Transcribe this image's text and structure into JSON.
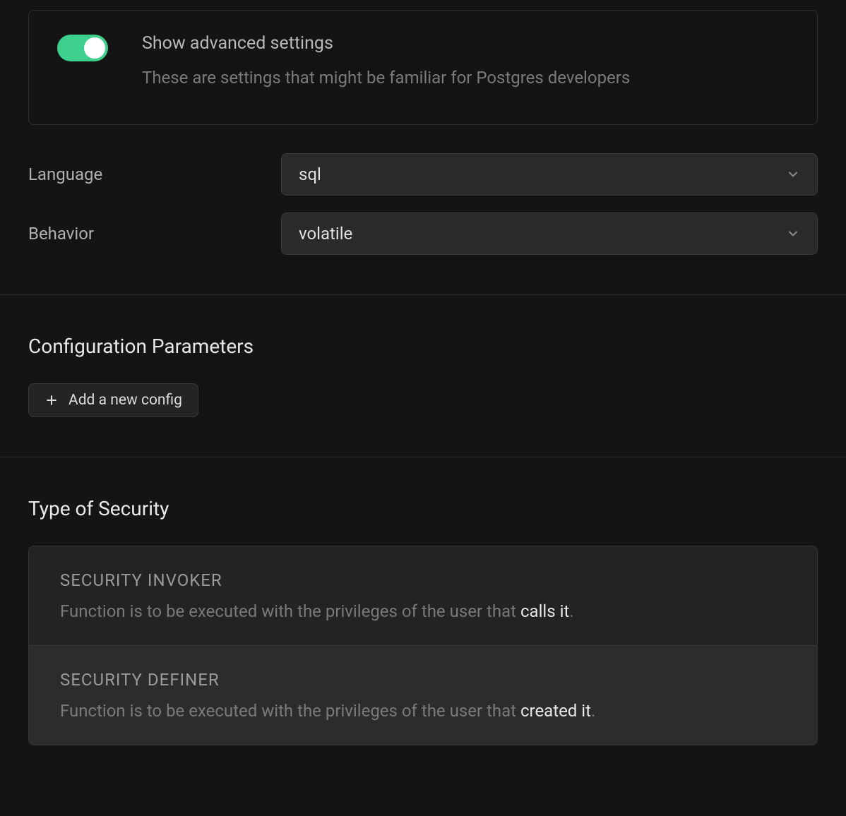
{
  "advanced": {
    "toggle_on": true,
    "title": "Show advanced settings",
    "description": "These are settings that might be familiar for Postgres developers"
  },
  "form": {
    "language": {
      "label": "Language",
      "value": "sql"
    },
    "behavior": {
      "label": "Behavior",
      "value": "volatile"
    }
  },
  "config": {
    "title": "Configuration Parameters",
    "add_label": "Add a new config"
  },
  "security": {
    "title": "Type of Security",
    "options": [
      {
        "name": "SECURITY INVOKER",
        "desc_prefix": "Function is to be executed with the privileges of the user that ",
        "desc_emph": "calls it",
        "desc_suffix": ".",
        "selected": false
      },
      {
        "name": "SECURITY DEFINER",
        "desc_prefix": "Function is to be executed with the privileges of the user that ",
        "desc_emph": "created it",
        "desc_suffix": ".",
        "selected": true
      }
    ]
  }
}
